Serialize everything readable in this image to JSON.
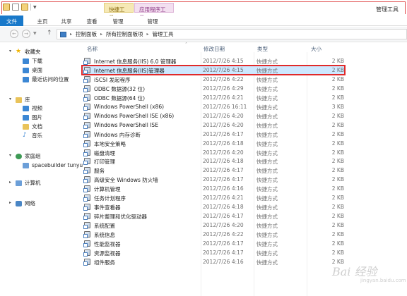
{
  "window": {
    "title": "管理工具",
    "contextual_tabs": [
      "快捷工具",
      "应用程序工具"
    ]
  },
  "ribbon": {
    "tabs": [
      {
        "label": "文件"
      },
      {
        "label": "主页"
      },
      {
        "label": "共享"
      },
      {
        "label": "查看"
      },
      {
        "label": "管理"
      },
      {
        "label": "管理"
      }
    ]
  },
  "address": {
    "back_icon": "back-arrow-icon",
    "forward_icon": "forward-arrow-icon",
    "up_icon": "up-arrow-icon",
    "breadcrumb": [
      "控制面板",
      "所有控制面板项",
      "管理工具"
    ]
  },
  "nav": {
    "favorites": {
      "label": "收藏夹",
      "items": [
        "下载",
        "桌面",
        "最近访问的位置"
      ]
    },
    "libraries": {
      "label": "库",
      "items": [
        "视频",
        "图片",
        "文档",
        "音乐"
      ]
    },
    "homegroup": {
      "label": "家庭组",
      "items": [
        "spacebuilder tunyu"
      ]
    },
    "computer": {
      "label": "计算机"
    },
    "network": {
      "label": "网络"
    }
  },
  "columns": {
    "name": "名称",
    "date": "修改日期",
    "type": "类型",
    "size": "大小"
  },
  "files": [
    {
      "name": "Internet 信息服务(IIS) 6.0 管理器",
      "date": "2012/7/26 4:15",
      "type": "快捷方式",
      "size": "2 KB"
    },
    {
      "name": "Internet 信息服务(IIS)管理器",
      "date": "2012/7/26 4:15",
      "type": "快捷方式",
      "size": "2 KB"
    },
    {
      "name": "iSCSI 发起程序",
      "date": "2012/7/26 4:22",
      "type": "快捷方式",
      "size": "2 KB"
    },
    {
      "name": "ODBC 数据源(32 位)",
      "date": "2012/7/26 4:29",
      "type": "快捷方式",
      "size": "2 KB"
    },
    {
      "name": "ODBC 数据源(64 位)",
      "date": "2012/7/26 4:21",
      "type": "快捷方式",
      "size": "2 KB"
    },
    {
      "name": "Windows PowerShell (x86)",
      "date": "2012/7/26 16:11",
      "type": "快捷方式",
      "size": "3 KB"
    },
    {
      "name": "Windows PowerShell ISE (x86)",
      "date": "2012/7/26 4:20",
      "type": "快捷方式",
      "size": "2 KB"
    },
    {
      "name": "Windows PowerShell ISE",
      "date": "2012/7/26 4:20",
      "type": "快捷方式",
      "size": "2 KB"
    },
    {
      "name": "Windows 内存诊断",
      "date": "2012/7/26 4:17",
      "type": "快捷方式",
      "size": "2 KB"
    },
    {
      "name": "本地安全策略",
      "date": "2012/7/26 4:18",
      "type": "快捷方式",
      "size": "2 KB"
    },
    {
      "name": "磁盘清理",
      "date": "2012/7/26 4:20",
      "type": "快捷方式",
      "size": "2 KB"
    },
    {
      "name": "打印管理",
      "date": "2012/7/26 4:18",
      "type": "快捷方式",
      "size": "2 KB"
    },
    {
      "name": "服务",
      "date": "2012/7/26 4:17",
      "type": "快捷方式",
      "size": "2 KB"
    },
    {
      "name": "高级安全 Windows 防火墙",
      "date": "2012/7/26 4:17",
      "type": "快捷方式",
      "size": "2 KB"
    },
    {
      "name": "计算机管理",
      "date": "2012/7/26 4:16",
      "type": "快捷方式",
      "size": "2 KB"
    },
    {
      "name": "任务计划程序",
      "date": "2012/7/26 4:21",
      "type": "快捷方式",
      "size": "2 KB"
    },
    {
      "name": "事件查看器",
      "date": "2012/7/26 4:18",
      "type": "快捷方式",
      "size": "2 KB"
    },
    {
      "name": "碎片整理和优化驱动器",
      "date": "2012/7/26 4:17",
      "type": "快捷方式",
      "size": "2 KB"
    },
    {
      "name": "系统配置",
      "date": "2012/7/26 4:20",
      "type": "快捷方式",
      "size": "2 KB"
    },
    {
      "name": "系统信息",
      "date": "2012/7/26 4:22",
      "type": "快捷方式",
      "size": "2 KB"
    },
    {
      "name": "性能监视器",
      "date": "2012/7/26 4:17",
      "type": "快捷方式",
      "size": "2 KB"
    },
    {
      "name": "资源监视器",
      "date": "2012/7/26 4:17",
      "type": "快捷方式",
      "size": "2 KB"
    },
    {
      "name": "组件服务",
      "date": "2012/7/26 4:16",
      "type": "快捷方式",
      "size": "2 KB"
    }
  ],
  "selected_file_index": 1,
  "watermark": {
    "text": "Bai 经验",
    "sub": "jingyan.baidu.com"
  }
}
